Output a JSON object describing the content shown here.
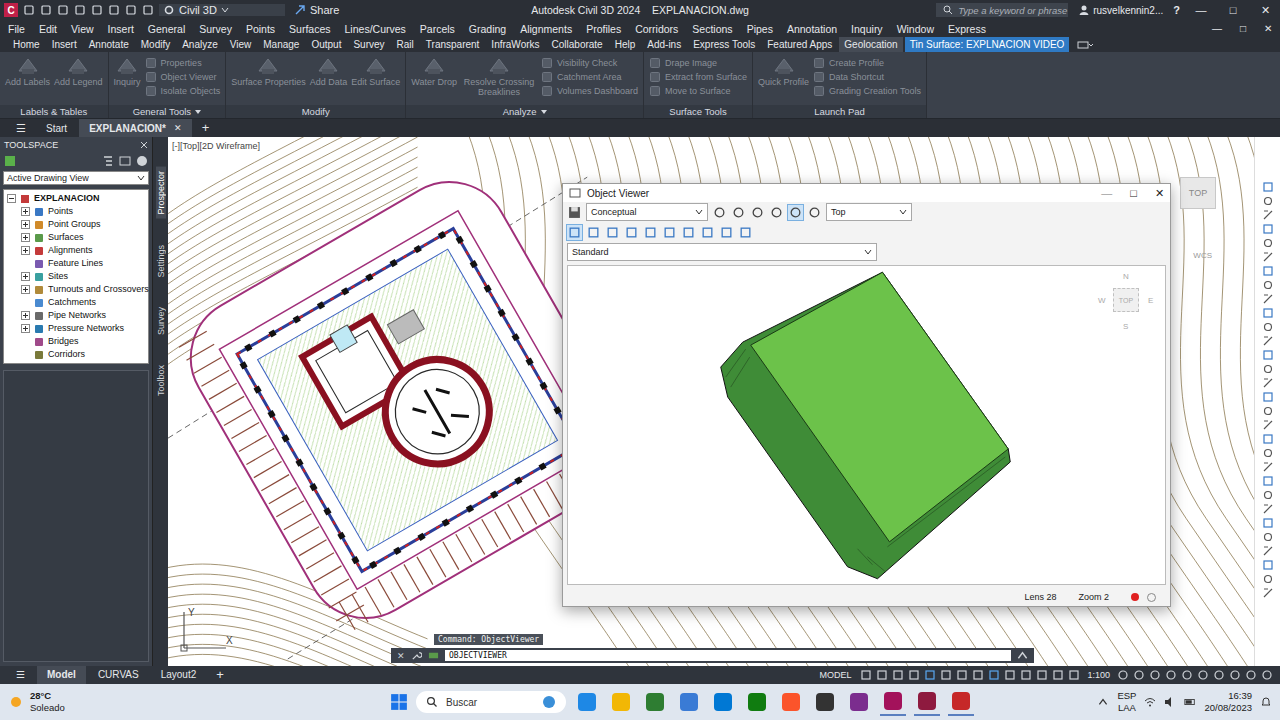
{
  "titlebar": {
    "app_letter": "C",
    "workspace": "Civil 3D",
    "share": "Share",
    "title": "Autodesk Civil 3D 2024    EXPLANACION.dwg",
    "search_placeholder": "Type a keyword or phrase",
    "user": "rusvelkennin2...",
    "help": "?",
    "controls": [
      "—",
      "□",
      "✕"
    ]
  },
  "menu": {
    "items": [
      "File",
      "Edit",
      "View",
      "Insert",
      "General",
      "Survey",
      "Points",
      "Surfaces",
      "Lines/Curves",
      "Parcels",
      "Grading",
      "Alignments",
      "Profiles",
      "Corridors",
      "Sections",
      "Pipes",
      "Annotation",
      "Inquiry",
      "Window",
      "Express"
    ],
    "controls": [
      "—",
      "□",
      "✕"
    ]
  },
  "ribbon": {
    "tabs": [
      {
        "label": "Home",
        "selected": false,
        "contextual": false
      },
      {
        "label": "Insert",
        "selected": false,
        "contextual": false
      },
      {
        "label": "Annotate",
        "selected": false,
        "contextual": false
      },
      {
        "label": "Modify",
        "selected": false,
        "contextual": false
      },
      {
        "label": "Analyze",
        "selected": false,
        "contextual": false
      },
      {
        "label": "View",
        "selected": false,
        "contextual": false
      },
      {
        "label": "Manage",
        "selected": false,
        "contextual": false
      },
      {
        "label": "Output",
        "selected": false,
        "contextual": false
      },
      {
        "label": "Survey",
        "selected": false,
        "contextual": false
      },
      {
        "label": "Rail",
        "selected": false,
        "contextual": false
      },
      {
        "label": "Transparent",
        "selected": false,
        "contextual": false
      },
      {
        "label": "InfraWorks",
        "selected": false,
        "contextual": false
      },
      {
        "label": "Collaborate",
        "selected": false,
        "contextual": false
      },
      {
        "label": "Help",
        "selected": false,
        "contextual": false
      },
      {
        "label": "Add-ins",
        "selected": false,
        "contextual": false
      },
      {
        "label": "Express Tools",
        "selected": false,
        "contextual": false
      },
      {
        "label": "Featured Apps",
        "selected": false,
        "contextual": false
      },
      {
        "label": "Geolocation",
        "selected": false,
        "contextual": true
      },
      {
        "label": "Tin Surface: EXPLNACION VIDEO",
        "selected": true,
        "contextual": true
      }
    ],
    "groups": [
      {
        "title": "Labels & Tables",
        "dropdown": false,
        "tools": [
          {
            "label": "Add Labels",
            "kind": "large",
            "disabled": true
          },
          {
            "label": "Add Legend",
            "kind": "large",
            "disabled": true
          }
        ]
      },
      {
        "title": "General Tools",
        "dropdown": true,
        "tools": [
          {
            "label": "Inquiry",
            "kind": "large",
            "disabled": true
          },
          {
            "label": "Properties",
            "kind": "small",
            "disabled": true
          },
          {
            "label": "Object Viewer",
            "kind": "small",
            "disabled": true
          },
          {
            "label": "Isolate Objects",
            "kind": "small",
            "disabled": true
          }
        ]
      },
      {
        "title": "Modify",
        "dropdown": false,
        "tools": [
          {
            "label": "Surface Properties",
            "kind": "large",
            "disabled": true
          },
          {
            "label": "Add Data",
            "kind": "large",
            "disabled": true
          },
          {
            "label": "Edit Surface",
            "kind": "large",
            "disabled": true
          }
        ]
      },
      {
        "title": "Analyze",
        "dropdown": true,
        "tools": [
          {
            "label": "Water Drop",
            "kind": "large",
            "disabled": true
          },
          {
            "label": "Resolve Crossing Breaklines",
            "kind": "large",
            "disabled": true
          },
          {
            "label": "Visibility Check",
            "kind": "small",
            "disabled": true
          },
          {
            "label": "Catchment Area",
            "kind": "small",
            "disabled": true
          },
          {
            "label": "Volumes Dashboard",
            "kind": "small",
            "disabled": true
          }
        ]
      },
      {
        "title": "Surface Tools",
        "dropdown": false,
        "tools": [
          {
            "label": "Drape Image",
            "kind": "small",
            "disabled": true
          },
          {
            "label": "Extract from Surface",
            "kind": "small",
            "disabled": true
          },
          {
            "label": "Move to Surface",
            "kind": "small",
            "disabled": true
          }
        ]
      },
      {
        "title": "Launch Pad",
        "dropdown": false,
        "tools": [
          {
            "label": "Quick Profile",
            "kind": "large",
            "disabled": true
          },
          {
            "label": "Create Profile",
            "kind": "small",
            "disabled": true
          },
          {
            "label": "Data Shortcut",
            "kind": "small",
            "disabled": true
          },
          {
            "label": "Grading Creation Tools",
            "kind": "small",
            "disabled": true
          }
        ]
      }
    ]
  },
  "doc_tabs": {
    "menu": "☰",
    "tabs": [
      {
        "label": "Start",
        "selected": false,
        "closable": false
      },
      {
        "label": "EXPLANACION*",
        "selected": true,
        "closable": true
      }
    ],
    "close": "✕",
    "add": "+"
  },
  "toolspace": {
    "title": "TOOLSPACE",
    "view": "Active Drawing View",
    "root": {
      "label": "EXPLANACION",
      "expanded": true
    },
    "items": [
      {
        "label": "Points",
        "expandable": true
      },
      {
        "label": "Point Groups",
        "expandable": true
      },
      {
        "label": "Surfaces",
        "expandable": true
      },
      {
        "label": "Alignments",
        "expandable": true
      },
      {
        "label": "Feature Lines",
        "expandable": false
      },
      {
        "label": "Sites",
        "expandable": true
      },
      {
        "label": "Turnouts and Crossovers",
        "expandable": true
      },
      {
        "label": "Catchments",
        "expandable": false
      },
      {
        "label": "Pipe Networks",
        "expandable": true
      },
      {
        "label": "Pressure Networks",
        "expandable": true
      },
      {
        "label": "Bridges",
        "expandable": false
      },
      {
        "label": "Corridors",
        "expandable": false
      }
    ],
    "side_tabs": [
      {
        "label": "Prospector",
        "selected": true
      },
      {
        "label": "Settings",
        "selected": false
      },
      {
        "label": "Survey",
        "selected": false
      },
      {
        "label": "Toolbox",
        "selected": false
      }
    ]
  },
  "viewport": {
    "label": "[-][Top][2D Wireframe]",
    "viewcube": "TOP",
    "wcs": "WCS",
    "ucs_x": "X",
    "ucs_y": "Y"
  },
  "object_viewer": {
    "title": "Object Viewer",
    "visual_style": "Conceptual",
    "view": "Top",
    "style": "Standard",
    "cube": {
      "top": "TOP",
      "n": "N",
      "s": "S",
      "e": "E",
      "w": "W"
    },
    "lens": "Lens 28",
    "zoom": "Zoom 2",
    "controls": [
      "—",
      "□",
      "✕"
    ]
  },
  "command": {
    "history": "Command: ObjectViewer",
    "close": "✕",
    "input": "OBJECTVIEWER"
  },
  "layout_tabs": {
    "menu": "☰",
    "tabs": [
      {
        "label": "Model",
        "selected": true
      },
      {
        "label": "CURVAS",
        "selected": false
      },
      {
        "label": "Layout2",
        "selected": false
      }
    ],
    "add": "+"
  },
  "status_bar": {
    "model": "MODEL",
    "scale": "1:100"
  },
  "taskbar": {
    "temp": "28°C",
    "weather": "Soleado",
    "search": "Buscar",
    "lang": "ESP",
    "layout": "LAA",
    "time": "16:39",
    "date": "20/08/2023"
  }
}
